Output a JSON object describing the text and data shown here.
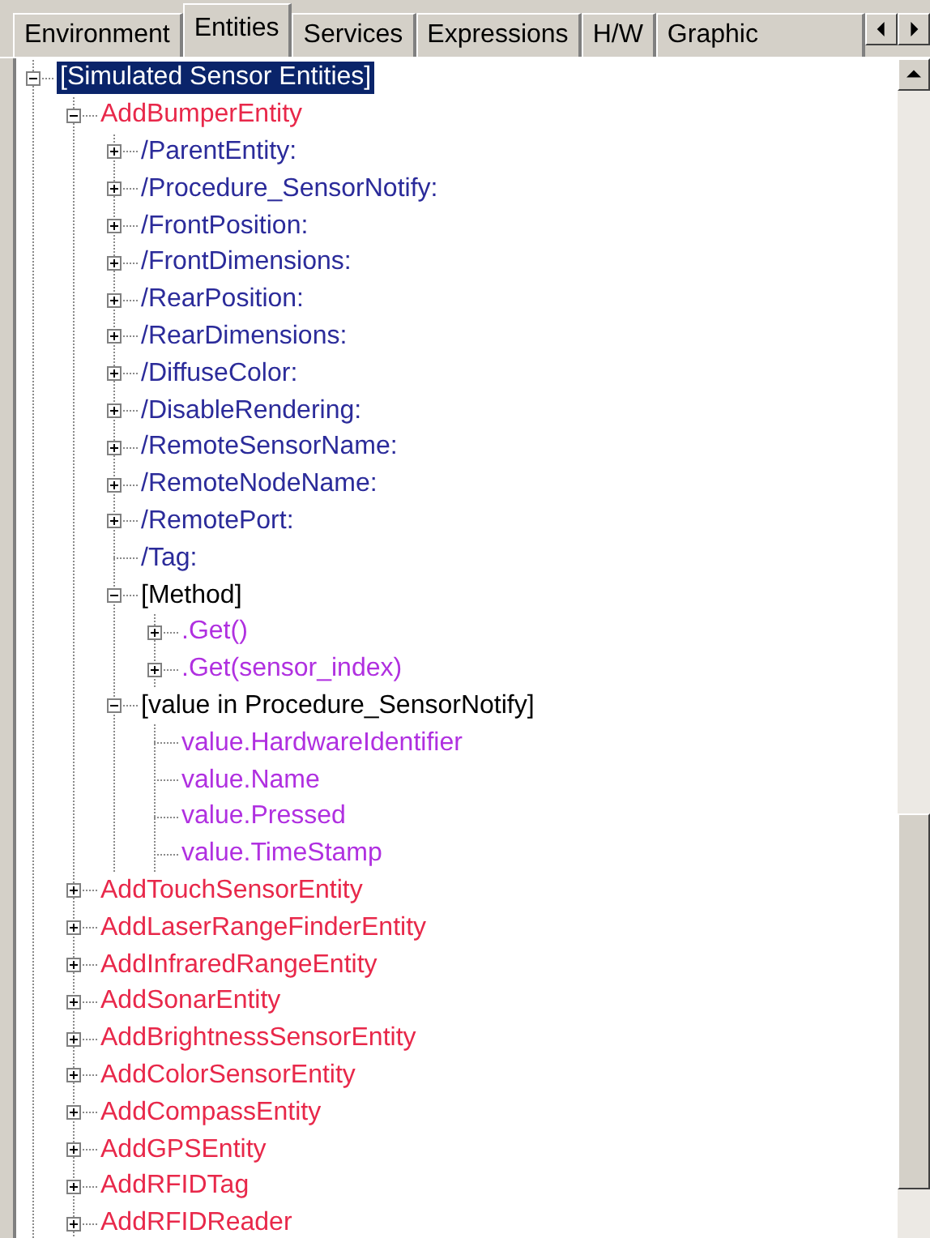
{
  "tabs": [
    {
      "label": "Environment",
      "selected": false
    },
    {
      "label": "Entities",
      "selected": true
    },
    {
      "label": "Services",
      "selected": false
    },
    {
      "label": "Expressions",
      "selected": false
    },
    {
      "label": "H/W",
      "selected": false
    },
    {
      "label": "Graphic",
      "selected": false
    }
  ],
  "tree": [
    {
      "label": "[Simulated Sensor Entities]",
      "selected": true,
      "expanded": true,
      "children": [
        {
          "label": "AddBumperEntity",
          "kind": "entity",
          "selected": false,
          "expanded": true,
          "children": [
            {
              "label": "/ParentEntity:",
              "kind": "property",
              "selected": false,
              "expanded": false
            },
            {
              "label": "/Procedure_SensorNotify:",
              "kind": "property",
              "selected": false,
              "expanded": false
            },
            {
              "label": "/FrontPosition:",
              "kind": "property",
              "selected": false,
              "expanded": false
            },
            {
              "label": "/FrontDimensions:",
              "kind": "property",
              "selected": false,
              "expanded": false
            },
            {
              "label": "/RearPosition:",
              "kind": "property",
              "selected": false,
              "expanded": false
            },
            {
              "label": "/RearDimensions:",
              "kind": "property",
              "selected": false,
              "expanded": false
            },
            {
              "label": "/DiffuseColor:",
              "kind": "property",
              "selected": false,
              "expanded": false
            },
            {
              "label": "/DisableRendering:",
              "kind": "property",
              "selected": false,
              "expanded": false
            },
            {
              "label": "/RemoteSensorName:",
              "kind": "property",
              "selected": false,
              "expanded": false
            },
            {
              "label": "/RemoteNodeName:",
              "kind": "property",
              "selected": false,
              "expanded": false
            },
            {
              "label": "/RemotePort:",
              "kind": "property",
              "selected": false,
              "expanded": false
            },
            {
              "label": "/Tag:",
              "kind": "property",
              "selected": false
            },
            {
              "label": "[Method]",
              "kind": "category",
              "selected": false,
              "expanded": true,
              "children": [
                {
                  "label": ".Get()",
                  "kind": "method",
                  "selected": false,
                  "expanded": false
                },
                {
                  "label": ".Get(sensor_index)",
                  "kind": "method",
                  "selected": false,
                  "expanded": false
                }
              ]
            },
            {
              "label": "[value in Procedure_SensorNotify]",
              "kind": "category",
              "selected": false,
              "expanded": true,
              "children": [
                {
                  "label": "value.HardwareIdentifier",
                  "kind": "method",
                  "selected": false
                },
                {
                  "label": "value.Name",
                  "kind": "method",
                  "selected": false
                },
                {
                  "label": "value.Pressed",
                  "kind": "method",
                  "selected": false
                },
                {
                  "label": "value.TimeStamp",
                  "kind": "method",
                  "selected": false
                }
              ]
            }
          ]
        },
        {
          "label": "AddTouchSensorEntity",
          "kind": "entity",
          "selected": false,
          "expanded": false
        },
        {
          "label": "AddLaserRangeFinderEntity",
          "kind": "entity",
          "selected": false,
          "expanded": false
        },
        {
          "label": "AddInfraredRangeEntity",
          "kind": "entity",
          "selected": false,
          "expanded": false
        },
        {
          "label": "AddSonarEntity",
          "kind": "entity",
          "selected": false,
          "expanded": false
        },
        {
          "label": "AddBrightnessSensorEntity",
          "kind": "entity",
          "selected": false,
          "expanded": false
        },
        {
          "label": "AddColorSensorEntity",
          "kind": "entity",
          "selected": false,
          "expanded": false
        },
        {
          "label": "AddCompassEntity",
          "kind": "entity",
          "selected": false,
          "expanded": false
        },
        {
          "label": "AddGPSEntity",
          "kind": "entity",
          "selected": false,
          "expanded": false
        },
        {
          "label": "AddRFIDTag",
          "kind": "entity",
          "selected": false,
          "expanded": false
        },
        {
          "label": "AddRFIDReader",
          "kind": "entity",
          "selected": false,
          "expanded": false
        }
      ]
    }
  ]
}
